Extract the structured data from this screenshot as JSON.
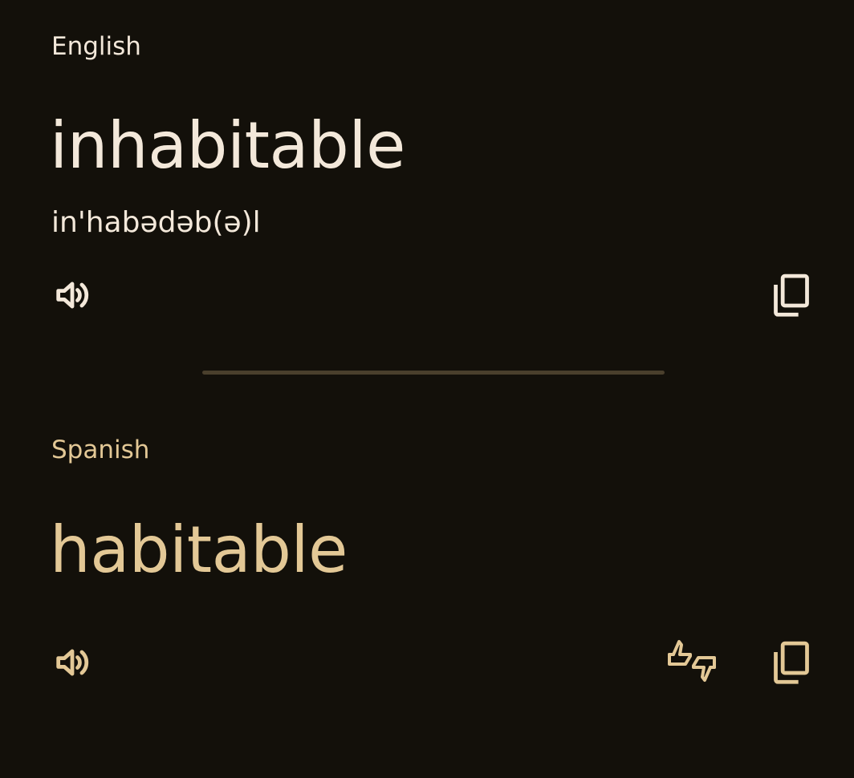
{
  "source": {
    "language": "English",
    "text": "inhabitable",
    "phonetic": "in'habədəb(ə)l",
    "speaker_icon": "speaker-icon",
    "copy_icon": "copy-icon"
  },
  "target": {
    "language": "Spanish",
    "text": "habitable",
    "speaker_icon": "speaker-icon",
    "feedback_icon": "thumbs-up-down-icon",
    "copy_icon": "copy-icon"
  },
  "colors": {
    "background": "#13100a",
    "source_text": "#f3e8da",
    "target_text": "#e3c896",
    "divider": "#4a3f2c"
  }
}
